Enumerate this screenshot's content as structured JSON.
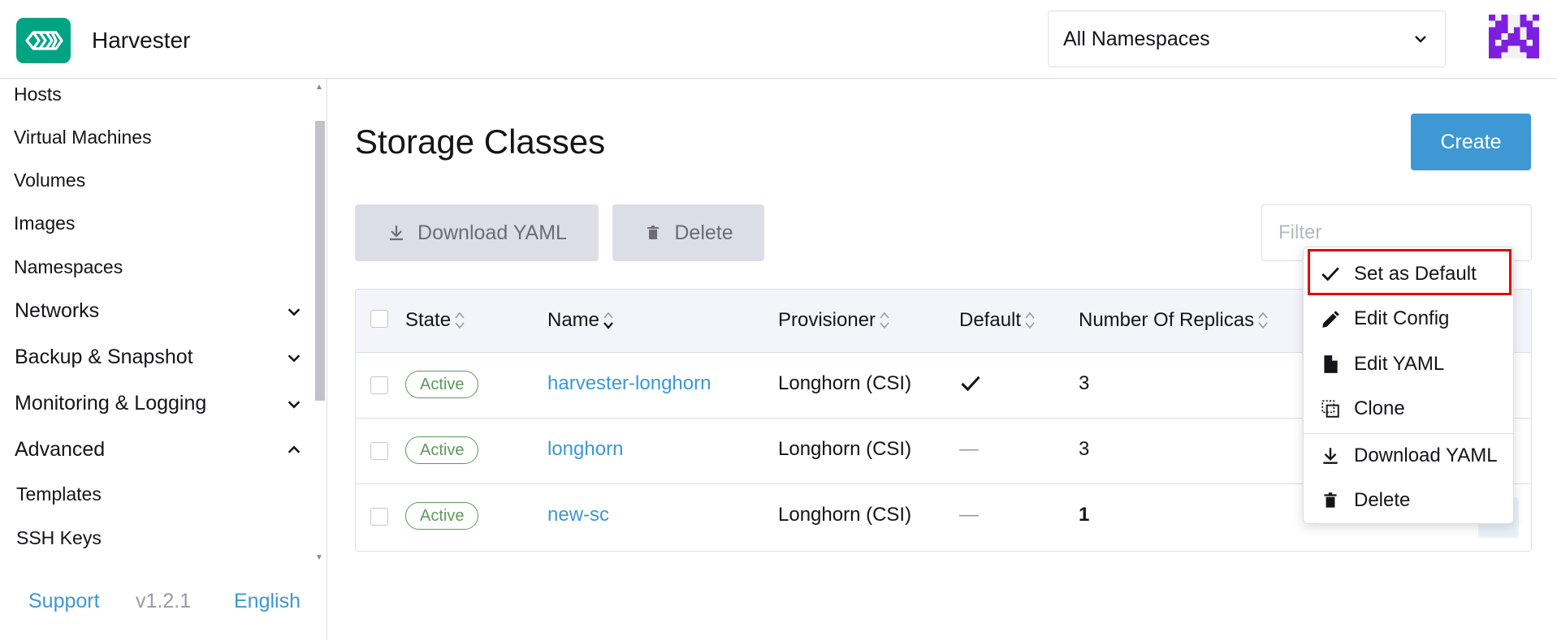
{
  "header": {
    "app_title": "Harvester",
    "namespace_select": {
      "value": "All Namespaces"
    }
  },
  "sidebar": {
    "items": [
      {
        "label": "Hosts"
      },
      {
        "label": "Virtual Machines"
      },
      {
        "label": "Volumes"
      },
      {
        "label": "Images"
      },
      {
        "label": "Namespaces"
      }
    ],
    "groups": [
      {
        "label": "Networks",
        "expanded": false
      },
      {
        "label": "Backup & Snapshot",
        "expanded": false
      },
      {
        "label": "Monitoring & Logging",
        "expanded": false
      },
      {
        "label": "Advanced",
        "expanded": true
      }
    ],
    "advanced_items": [
      {
        "label": "Templates"
      },
      {
        "label": "SSH Keys"
      }
    ],
    "footer": {
      "support": "Support",
      "version": "v1.2.1",
      "language": "English"
    }
  },
  "main": {
    "title": "Storage Classes",
    "create_label": "Create",
    "download_yaml_label": "Download YAML",
    "delete_label": "Delete",
    "filter_placeholder": "Filter",
    "table": {
      "columns": [
        "State",
        "Name",
        "Provisioner",
        "Default",
        "Number Of Replicas"
      ],
      "rows": [
        {
          "state": "Active",
          "name": "harvester-longhorn",
          "provisioner": "Longhorn (CSI)",
          "default": true,
          "replicas": "3"
        },
        {
          "state": "Active",
          "name": "longhorn",
          "provisioner": "Longhorn (CSI)",
          "default": false,
          "default_text": "—",
          "replicas": "3"
        },
        {
          "state": "Active",
          "name": "new-sc",
          "provisioner": "Longhorn (CSI)",
          "default": false,
          "default_text": "—",
          "replicas": "1"
        }
      ]
    }
  },
  "action_menu": {
    "items": [
      {
        "label": "Set as Default",
        "icon": "checkmark-icon"
      },
      {
        "label": "Edit Config",
        "icon": "pencil-icon"
      },
      {
        "label": "Edit YAML",
        "icon": "file-icon"
      },
      {
        "label": "Clone",
        "icon": "clone-icon"
      },
      {
        "label": "Download YAML",
        "icon": "download-icon"
      },
      {
        "label": "Delete",
        "icon": "trash-icon"
      }
    ]
  },
  "colors": {
    "accent": "#3d98d3",
    "brand": "#00a483",
    "active": "#5d995d",
    "highlight": "#e60000"
  }
}
